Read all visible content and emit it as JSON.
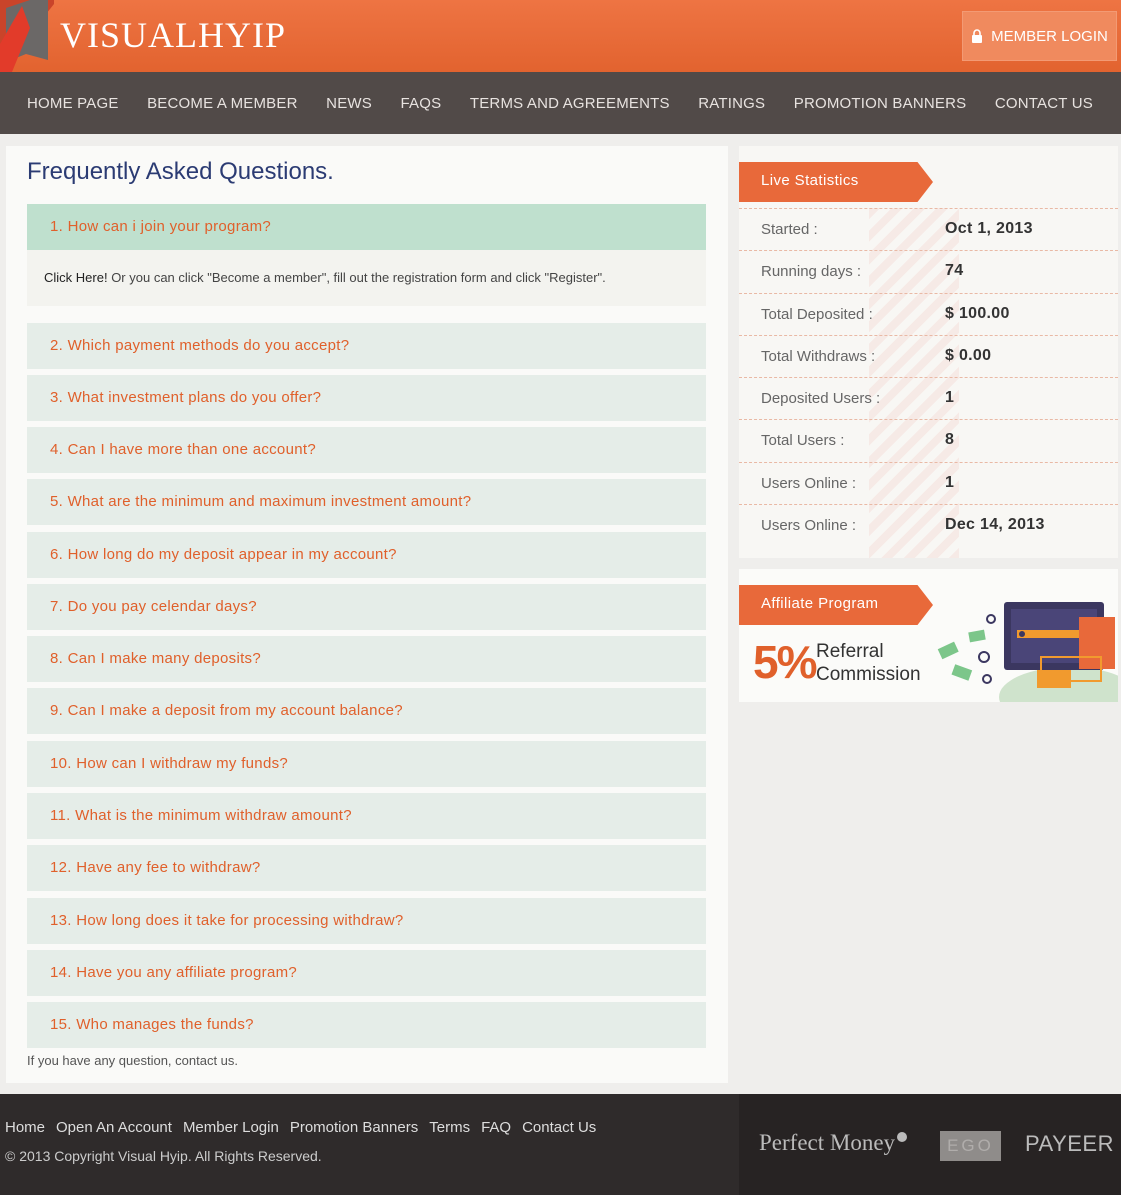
{
  "header": {
    "logo_text": "VISUALHYIP",
    "login_label": "MEMBER LOGIN",
    "colors": {
      "brand": "#e8693a",
      "nav": "#514a48"
    }
  },
  "nav": {
    "items": [
      {
        "label": "HOME PAGE"
      },
      {
        "label": "BECOME A MEMBER"
      },
      {
        "label": "NEWS"
      },
      {
        "label": "FAQS"
      },
      {
        "label": "TERMS AND AGREEMENTS"
      },
      {
        "label": "RATINGS"
      },
      {
        "label": "PROMOTION BANNERS"
      },
      {
        "label": "CONTACT US"
      }
    ]
  },
  "faq": {
    "title": "Frequently Asked Questions.",
    "open_question": "1. How can i join your program?",
    "answer_link": "Click Here!",
    "answer_text": " Or you can click \"Become a member\", fill out the registration form and click \"Register\".",
    "questions": [
      "2. Which payment methods do you accept?",
      "3. What investment plans do you offer?",
      "4. Can I have more than one account?",
      "5. What are the minimum and maximum investment amount?",
      "6. How long do my deposit appear in my account?",
      "7. Do you pay celendar days?",
      "8. Can I make many deposits?",
      "9. Can I make a deposit from my account balance?",
      "10. How can I withdraw my funds?",
      "11. What is the minimum withdraw amount?",
      "12. Have any fee to withdraw?",
      "13. How long does it take for processing withdraw?",
      "14. Have you any affiliate program?",
      "15. Who manages the funds?"
    ],
    "footer_text": "If you have any question, contact us."
  },
  "stats": {
    "title": "Live Statistics",
    "rows": [
      {
        "label": "Started :",
        "value": "Oct 1, 2013"
      },
      {
        "label": "Running days :",
        "value": "74"
      },
      {
        "label": "Total Deposited :",
        "value": "$ 100.00"
      },
      {
        "label": "Total Withdraws :",
        "value": "$ 0.00"
      },
      {
        "label": "Deposited Users :",
        "value": "1"
      },
      {
        "label": "Total Users :",
        "value": "8"
      },
      {
        "label": "Users Online :",
        "value": "1"
      },
      {
        "label": "Users Online :",
        "value": "Dec 14, 2013"
      }
    ]
  },
  "affiliate": {
    "title": "Affiliate Program",
    "percent": "5%",
    "line1": "Referral",
    "line2": "Commission"
  },
  "footer": {
    "links": [
      "Home",
      "Open An Account",
      "Member Login",
      "Promotion Banners",
      "Terms",
      "FAQ",
      "Contact Us"
    ],
    "copyright": "© 2013 Copyright Visual Hyip. All Rights Reserved.",
    "payments": {
      "perfect_money": "Perfect Money",
      "ego": "EGO",
      "payeer": "PAYEER"
    }
  }
}
